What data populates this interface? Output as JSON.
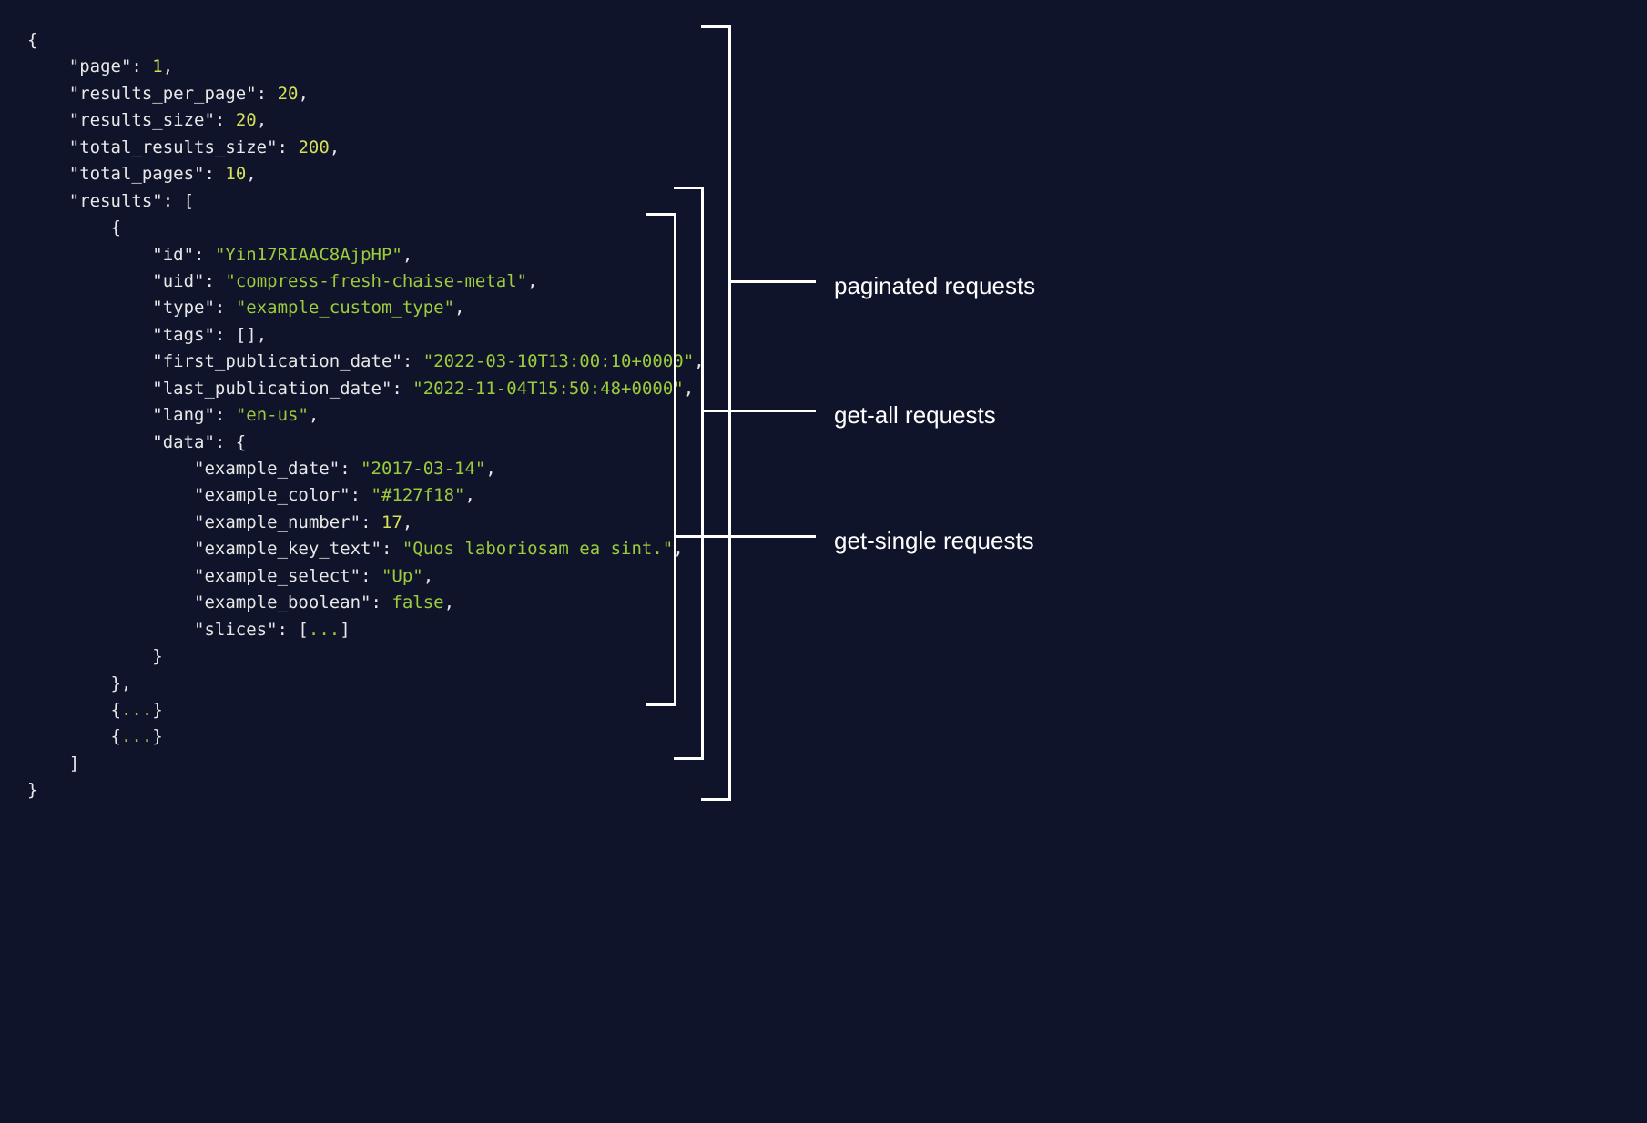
{
  "code": {
    "page_key": "\"page\"",
    "page_val": "1",
    "rpp_key": "\"results_per_page\"",
    "rpp_val": "20",
    "rs_key": "\"results_size\"",
    "rs_val": "20",
    "trs_key": "\"total_results_size\"",
    "trs_val": "200",
    "tp_key": "\"total_pages\"",
    "tp_val": "10",
    "results_key": "\"results\"",
    "id_key": "\"id\"",
    "id_val": "\"Yin17RIAAC8AjpHP\"",
    "uid_key": "\"uid\"",
    "uid_val": "\"compress-fresh-chaise-metal\"",
    "type_key": "\"type\"",
    "type_val": "\"example_custom_type\"",
    "tags_key": "\"tags\"",
    "tags_val": "[]",
    "fpd_key": "\"first_publication_date\"",
    "fpd_val": "\"2022-03-10T13:00:10+0000\"",
    "lpd_key": "\"last_publication_date\"",
    "lpd_val": "\"2022-11-04T15:50:48+0000\"",
    "lang_key": "\"lang\"",
    "lang_val": "\"en-us\"",
    "data_key": "\"data\"",
    "ed_key": "\"example_date\"",
    "ed_val": "\"2017-03-14\"",
    "ec_key": "\"example_color\"",
    "ec_val": "\"#127f18\"",
    "en_key": "\"example_number\"",
    "en_val": "17",
    "ekt_key": "\"example_key_text\"",
    "ekt_val": "\"Quos laboriosam ea sint.\"",
    "es_key": "\"example_select\"",
    "es_val": "\"Up\"",
    "eb_key": "\"example_boolean\"",
    "eb_val": "false",
    "slices_key": "\"slices\"",
    "slices_val": "...",
    "ellipsis": "..."
  },
  "labels": {
    "paginated": "paginated requests",
    "getall": "get-all requests",
    "getsingle": "get-single requests"
  }
}
